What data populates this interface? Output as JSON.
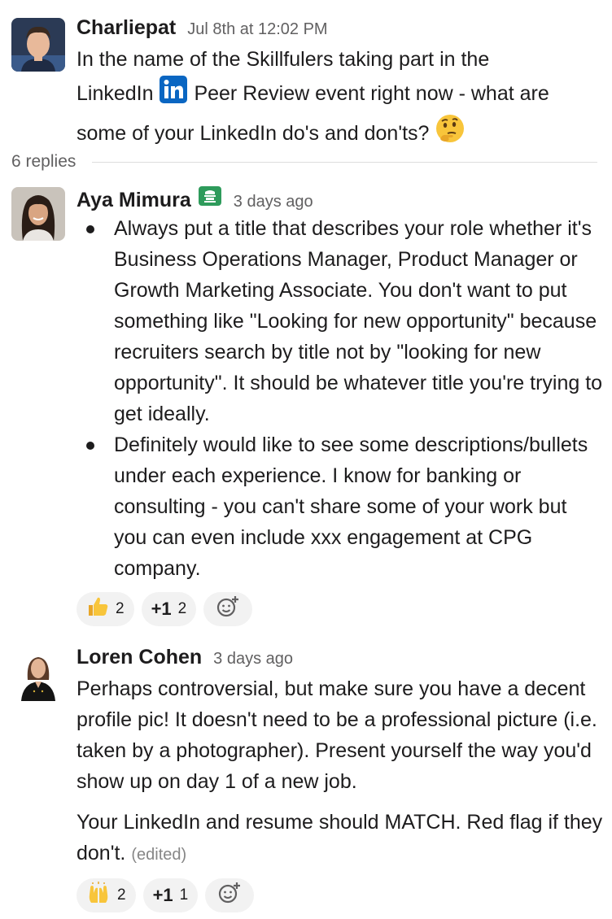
{
  "messages": [
    {
      "author": "Charliepat",
      "time": "Jul 8th at 12:02 PM",
      "text_part1": "In the name of the Skillfulers taking part in the",
      "text_part2": "LinkedIn",
      "text_part3": "Peer Review event right now - what are",
      "text_part4": "some of your LinkedIn do's and don'ts?",
      "emoji": "thinking-face-icon"
    },
    {
      "author": "Aya Mimura",
      "time": "3 days ago",
      "badge_icon": "knight-badge-icon",
      "bullets": [
        "Always put a title that describes your role whether it's Business Operations Manager, Product Manager or Growth Marketing Associate. You don't want to put something like \"Looking for new opportunity\" because recruiters search by title not by \"looking for new opportunity\". It should be whatever title you're trying to get ideally.",
        "Definitely would like to see some descriptions/bullets under each experience. I know for banking or consulting - you can't share some of your work but you can even include xxx engagement at CPG company."
      ],
      "reactions": [
        {
          "icon": "thumbs-up-icon",
          "count": "2"
        },
        {
          "label": "+1",
          "count": "2"
        }
      ]
    },
    {
      "author": "Loren Cohen",
      "time": "3 days ago",
      "paragraph1": "Perhaps controversial, but make sure you have a decent profile pic! It doesn't need to be a professional picture (i.e. taken by a photographer). Present yourself the way you'd show up on day 1 of a new job.",
      "paragraph2": "Your LinkedIn and resume should MATCH. Red flag if they don't.",
      "edited": "(edited)",
      "reactions": [
        {
          "icon": "raised-hands-icon",
          "count": "2"
        },
        {
          "label": "+1",
          "count": "1"
        }
      ]
    }
  ],
  "thread": {
    "replies_label": "6 replies"
  },
  "colors": {
    "text": "#1d1c1d",
    "muted": "#616061",
    "pill_bg": "#f2f2f2",
    "linkedin_blue": "#0a66c2",
    "badge_green": "#2e9b5b"
  }
}
